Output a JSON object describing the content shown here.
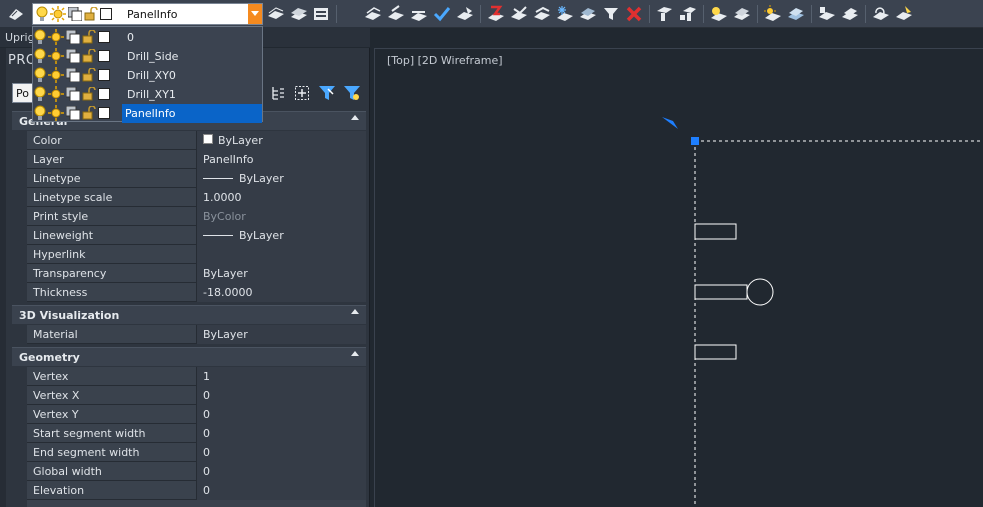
{
  "toolbar": {
    "current_layer": "PanelInfo"
  },
  "layer_dropdown": {
    "items": [
      {
        "name": "0"
      },
      {
        "name": "Drill_Side"
      },
      {
        "name": "Drill_XY0"
      },
      {
        "name": "Drill_XY1"
      },
      {
        "name": "PanelInfo",
        "selected": true
      }
    ]
  },
  "left_strip": {
    "label": "Uprig"
  },
  "properties": {
    "title": "PRO",
    "object_select": "Po",
    "sections": {
      "general": {
        "title": "General",
        "rows": [
          {
            "name": "Color",
            "value": "ByLayer"
          },
          {
            "name": "Layer",
            "value": "PanelInfo"
          },
          {
            "name": "Linetype",
            "value": "ByLayer"
          },
          {
            "name": "Linetype scale",
            "value": "1.0000"
          },
          {
            "name": "Print style",
            "value": "ByColor"
          },
          {
            "name": "Lineweight",
            "value": "ByLayer"
          },
          {
            "name": "Hyperlink",
            "value": ""
          },
          {
            "name": "Transparency",
            "value": "ByLayer"
          },
          {
            "name": "Thickness",
            "value": "-18.0000"
          }
        ]
      },
      "visualization": {
        "title": "3D Visualization",
        "rows": [
          {
            "name": "Material",
            "value": "ByLayer"
          }
        ]
      },
      "geometry": {
        "title": "Geometry",
        "rows": [
          {
            "name": "Vertex",
            "value": "1"
          },
          {
            "name": "Vertex X",
            "value": "0"
          },
          {
            "name": "Vertex Y",
            "value": "0"
          },
          {
            "name": "Start segment width",
            "value": "0"
          },
          {
            "name": "End segment width",
            "value": "0"
          },
          {
            "name": "Global width",
            "value": "0"
          },
          {
            "name": "Elevation",
            "value": "0"
          }
        ]
      }
    }
  },
  "viewport": {
    "label": "[Top] [2D Wireframe]"
  },
  "colors": {
    "accent": "#0a64c8",
    "combo_arrow": "#f58a1f",
    "grip": "#1e7fff",
    "background": "#212830"
  }
}
